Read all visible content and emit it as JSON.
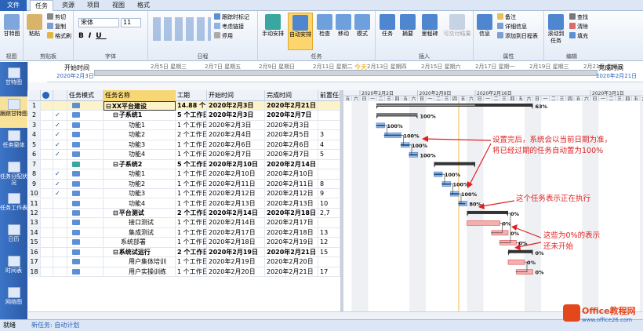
{
  "tabs": [
    "文件",
    "任务",
    "资源",
    "项目",
    "视图",
    "格式"
  ],
  "ribbon": {
    "view_group": {
      "label": "视图",
      "btn": "甘特图"
    },
    "clipboard": {
      "label": "剪贴板",
      "paste": "粘贴",
      "cut": "剪切",
      "copy": "复制",
      "format": "格式刷"
    },
    "font": {
      "label": "字体",
      "name": "宋体",
      "size": "11"
    },
    "schedule": {
      "label": "日程",
      "track": "跟踪时标记",
      "respect": "考虑链接",
      "deactivate": "停用"
    },
    "tasks": {
      "label": "任务",
      "manual": "手动安排",
      "auto": "自动安排",
      "inspect": "检查",
      "move": "移动",
      "mode": "模式"
    },
    "insert": {
      "label": "插入",
      "task": "任务",
      "summary": "摘要",
      "milestone": "里程碑",
      "deliverable": "可交付结果"
    },
    "properties": {
      "label": "属性",
      "info": "信息",
      "notes": "备注",
      "details": "详细信息",
      "add_timeline": "添加到日程表"
    },
    "editing": {
      "label": "编辑",
      "scroll": "滚动到任务",
      "find": "查找",
      "clear": "清除",
      "fill": "填充"
    }
  },
  "timeline": {
    "start_label": "开始时间",
    "start_date": "2020年2月3日",
    "end_label": "完成时间",
    "end_date": "2020年2月21日",
    "today": "今天",
    "ticks": [
      "2月5日 星期三",
      "2月7日 星期五",
      "2月9日 星期日",
      "2月11日 星期二",
      "2月13日 星期四",
      "2月15日 星期六",
      "2月17日 星期一",
      "2月19日 星期三",
      "2月21日 星期五"
    ]
  },
  "sidebar": [
    "甘特图",
    "跟踪甘特图",
    "任务窗体",
    "任务分配状况",
    "任务工作表",
    "日历",
    "时间表",
    "网络图"
  ],
  "columns": [
    "任务模式",
    "任务名称",
    "工期",
    "开始时间",
    "完成时间",
    "前置任务"
  ],
  "rows": [
    {
      "id": "1",
      "name": "XX平台建设",
      "dur": "14.88 个",
      "start": "2020年2月3日",
      "finish": "2020年2月21日",
      "pred": "",
      "lvl": 0,
      "sum": true,
      "check": false
    },
    {
      "id": "2",
      "name": "子系统1",
      "dur": "5 个工作日",
      "start": "2020年2月3日",
      "finish": "2020年2月7日",
      "pred": "",
      "lvl": 1,
      "sum": true,
      "check": true
    },
    {
      "id": "3",
      "name": "功能1",
      "dur": "1 个工作日",
      "start": "2020年2月3日",
      "finish": "2020年2月3日",
      "pred": "",
      "lvl": 2,
      "sum": false,
      "check": true
    },
    {
      "id": "4",
      "name": "功能2",
      "dur": "2 个工作日",
      "start": "2020年2月4日",
      "finish": "2020年2月5日",
      "pred": "3",
      "lvl": 2,
      "sum": false,
      "check": true
    },
    {
      "id": "5",
      "name": "功能3",
      "dur": "1 个工作日",
      "start": "2020年2月6日",
      "finish": "2020年2月6日",
      "pred": "4",
      "lvl": 2,
      "sum": false,
      "check": true
    },
    {
      "id": "6",
      "name": "功能4",
      "dur": "1 个工作日",
      "start": "2020年2月7日",
      "finish": "2020年2月7日",
      "pred": "5",
      "lvl": 2,
      "sum": false,
      "check": true
    },
    {
      "id": "7",
      "name": "子系统2",
      "dur": "5 个工作日",
      "start": "2020年2月10日",
      "finish": "2020年2月14日",
      "pred": "",
      "lvl": 1,
      "sum": true,
      "check": false
    },
    {
      "id": "8",
      "name": "功能1",
      "dur": "1 个工作日",
      "start": "2020年2月10日",
      "finish": "2020年2月10日",
      "pred": "",
      "lvl": 2,
      "sum": false,
      "check": true
    },
    {
      "id": "9",
      "name": "功能2",
      "dur": "1 个工作日",
      "start": "2020年2月11日",
      "finish": "2020年2月11日",
      "pred": "8",
      "lvl": 2,
      "sum": false,
      "check": true
    },
    {
      "id": "10",
      "name": "功能3",
      "dur": "1 个工作日",
      "start": "2020年2月12日",
      "finish": "2020年2月12日",
      "pred": "9",
      "lvl": 2,
      "sum": false,
      "check": true
    },
    {
      "id": "11",
      "name": "功能4",
      "dur": "1 个工作日",
      "start": "2020年2月13日",
      "finish": "2020年2月13日",
      "pred": "10",
      "lvl": 2,
      "sum": false,
      "check": false
    },
    {
      "id": "12",
      "name": "平台测试",
      "dur": "2 个工作日",
      "start": "2020年2月14日",
      "finish": "2020年2月18日",
      "pred": "2,7",
      "lvl": 1,
      "sum": true,
      "check": false
    },
    {
      "id": "13",
      "name": "接口测试",
      "dur": "1 个工作日",
      "start": "2020年2月14日",
      "finish": "2020年2月17日",
      "pred": "",
      "lvl": 2,
      "sum": false,
      "check": false
    },
    {
      "id": "14",
      "name": "集成测试",
      "dur": "1 个工作日",
      "start": "2020年2月17日",
      "finish": "2020年2月18日",
      "pred": "13",
      "lvl": 2,
      "sum": false,
      "check": false
    },
    {
      "id": "15",
      "name": "系统部署",
      "dur": "1 个工作日",
      "start": "2020年2月18日",
      "finish": "2020年2月19日",
      "pred": "12",
      "lvl": 1,
      "sum": false,
      "check": false
    },
    {
      "id": "16",
      "name": "系统试运行",
      "dur": "2 个工作日",
      "start": "2020年2月19日",
      "finish": "2020年2月21日",
      "pred": "15",
      "lvl": 1,
      "sum": true,
      "check": false
    },
    {
      "id": "17",
      "name": "用户集体培训",
      "dur": "1 个工作日",
      "start": "2020年2月19日",
      "finish": "2020年2月20日",
      "pred": "",
      "lvl": 2,
      "sum": false,
      "check": false
    },
    {
      "id": "18",
      "name": "用户实操训练",
      "dur": "1 个工作日",
      "start": "2020年2月20日",
      "finish": "2020年2月21日",
      "pred": "17",
      "lvl": 2,
      "sum": false,
      "check": false
    }
  ],
  "gantt": {
    "weeks": [
      "2020年2月2日",
      "2020年2月9日",
      "2020年2月16日",
      "2020年3月1日"
    ],
    "days": "五六日一二三四五六日一二三四五六日一二三四五六日一二三四五六日一二三四五六日一",
    "bars": [
      {
        "pct": "63%"
      },
      {
        "pct": "100%"
      },
      {
        "pct": "100%"
      },
      {
        "pct": "100%"
      },
      {
        "pct": "100%"
      },
      {
        "pct": "100%"
      },
      {
        "pct": ""
      },
      {
        "pct": "100%"
      },
      {
        "pct": "100%"
      },
      {
        "pct": "100%"
      },
      {
        "pct": "80%"
      },
      {
        "pct": "0%"
      },
      {
        "pct": "0%"
      },
      {
        "pct": "0%"
      },
      {
        "pct": "0%"
      },
      {
        "pct": "0%"
      },
      {
        "pct": "0%"
      },
      {
        "pct": "0%"
      }
    ],
    "annotations": [
      "设置完后，系统会以当前日期为准，",
      "将已经过期的任务自动置为100%",
      "这个任务表示正在执行",
      "这些为0%的表示",
      "还未开始"
    ]
  },
  "status": {
    "ready": "就绪",
    "new_task": "新任务: 自动计划"
  },
  "watermark": {
    "name": "Office教程网",
    "url": "www.office26.com"
  }
}
